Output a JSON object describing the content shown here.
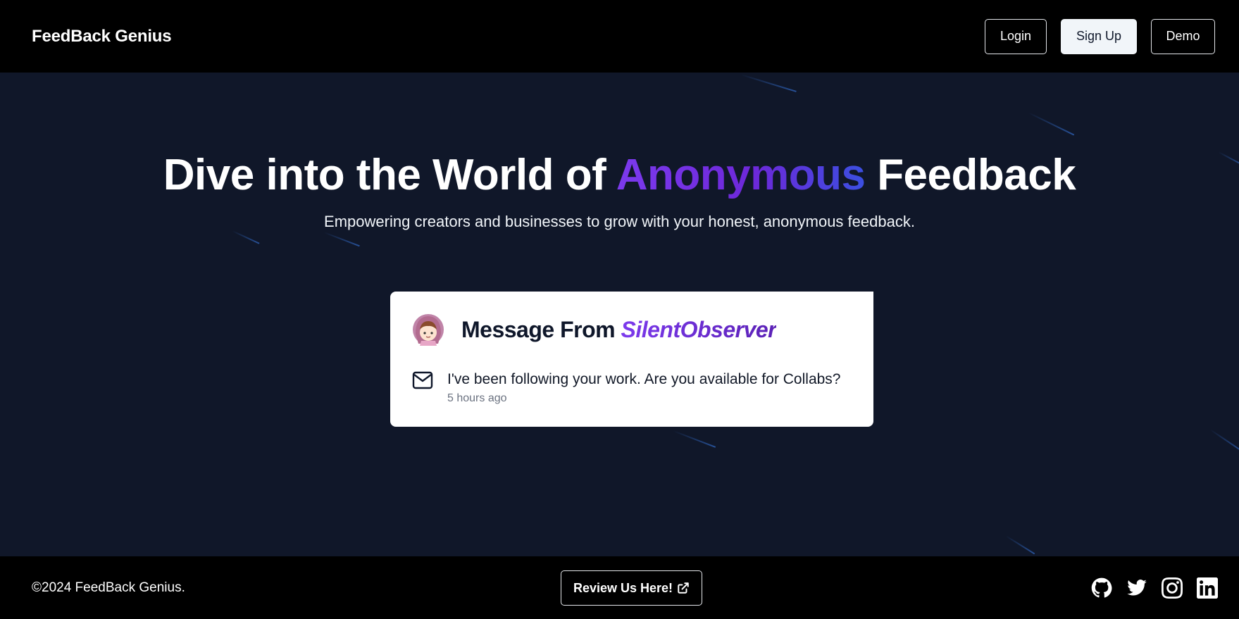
{
  "navbar": {
    "brand": "FeedBack Genius",
    "login_label": "Login",
    "signup_label": "Sign Up",
    "demo_label": "Demo"
  },
  "hero": {
    "title_before": "Dive into the World of",
    "title_accent": "Anonymous",
    "title_after": "Feedback",
    "subtitle": "Empowering creators and businesses to grow with your honest, anonymous feedback."
  },
  "message_card": {
    "heading_prefix": "Message From",
    "sender": "SilentObserver",
    "content": "I've been following your work. Are you available for Collabs?",
    "received": "5 hours ago",
    "avatar_icon": "anime-girl-avatar",
    "message_icon": "mail-icon"
  },
  "footer": {
    "copyright": "©2024 FeedBack Genius.",
    "review_label": "Review Us Here!",
    "review_icon": "external-link-icon",
    "social_icons": [
      "github-icon",
      "twitter-icon",
      "instagram-icon",
      "linkedin-icon"
    ]
  },
  "colors": {
    "background": "#101729",
    "nav_background": "#000000",
    "accent_purple": "#7c3aed",
    "accent_blue": "#3b4fe0",
    "card_background": "#ffffff"
  }
}
